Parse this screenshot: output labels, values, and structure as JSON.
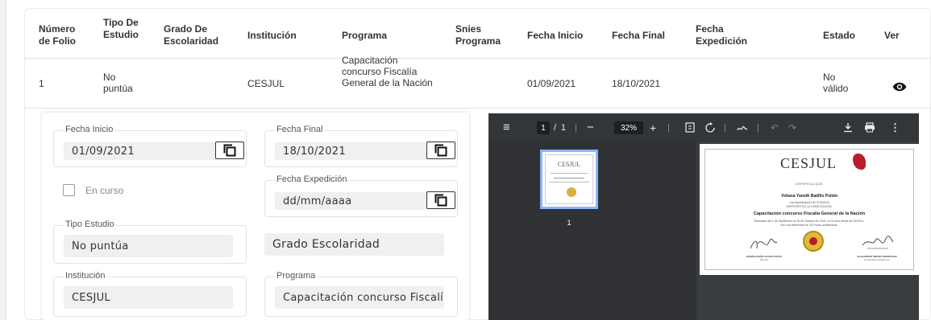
{
  "table": {
    "headers": {
      "folio": "Número de Folio",
      "tipo": "Tipo De Estudio",
      "grado": "Grado De Escolaridad",
      "institucion": "Institución",
      "programa": "Programa",
      "snies": "Snies Programa",
      "fecha_inicio": "Fecha Inicio",
      "fecha_final": "Fecha Final",
      "fecha_exp": "Fecha Expedición",
      "estado": "Estado",
      "ver": "Ver"
    },
    "row": {
      "folio": "1",
      "tipo": "No puntúa",
      "grado": "",
      "institucion": "CESJUL",
      "programa": "Capacitación concurso Fiscalía General de la Nación",
      "snies": "",
      "fecha_inicio": "01/09/2021",
      "fecha_final": "18/10/2021",
      "fecha_exp": "",
      "estado": "No válido"
    }
  },
  "form": {
    "fecha_inicio": {
      "label": "Fecha Inicio",
      "value": "01/09/2021"
    },
    "fecha_final": {
      "label": "Fecha Final",
      "value": "18/10/2021"
    },
    "en_curso": {
      "label": "En curso",
      "checked": false
    },
    "fecha_expedicion": {
      "label": "Fecha Expedición",
      "placeholder": "dd/mm/aaaa"
    },
    "tipo_estudio": {
      "label": "Tipo Estudio",
      "value": "No puntúa"
    },
    "grado_escolaridad": {
      "placeholder": "Grado Escolaridad"
    },
    "institucion": {
      "label": "Institución",
      "value": "CESJUL"
    },
    "programa": {
      "label": "Programa",
      "value": "Capacitación concurso Fiscalí"
    }
  },
  "pdf_viewer": {
    "page_current": "1",
    "page_sep": "/",
    "page_total": "1",
    "zoom": "32%",
    "thumb_label": "1",
    "icons": [
      "menu-icon",
      "zoom-out-icon",
      "zoom-in-icon",
      "fit-page-icon",
      "rotate-icon",
      "annotate-icon",
      "undo-icon",
      "redo-icon",
      "download-icon",
      "print-icon",
      "more-icon"
    ],
    "certificate": {
      "brand": "CESJUL",
      "certifica": "CERTIFICA A QUE:",
      "name": "Yohana Yaneth Badillo Pulido",
      "id_line": "Con identificación No 37940040",
      "participo": "PARTICIPÓ EN LA CAPACITACIÓN:",
      "course": "Capacitación concurso Fiscalía General de la Nación",
      "detail1": "Realizado del 1 de Septiembre al 18 de Octubre del 2021, en el aula virtual de CESJUL,",
      "detail2": "con una intensidad de 100 horas académicas.",
      "sig1_name": "RUBÉN DARÍO ACOSTA ORTIZ",
      "sig1_role": "Director",
      "sig2_name": "ALEXANDER SIERRA RODRÍGUEZ",
      "sig2_role": "Coordinador Académico"
    }
  },
  "colors": {
    "toolbar": "#323639",
    "sidebar": "#2f3134",
    "thumb_border": "#8ab4f8",
    "input_bg": "#f0f0f0"
  }
}
